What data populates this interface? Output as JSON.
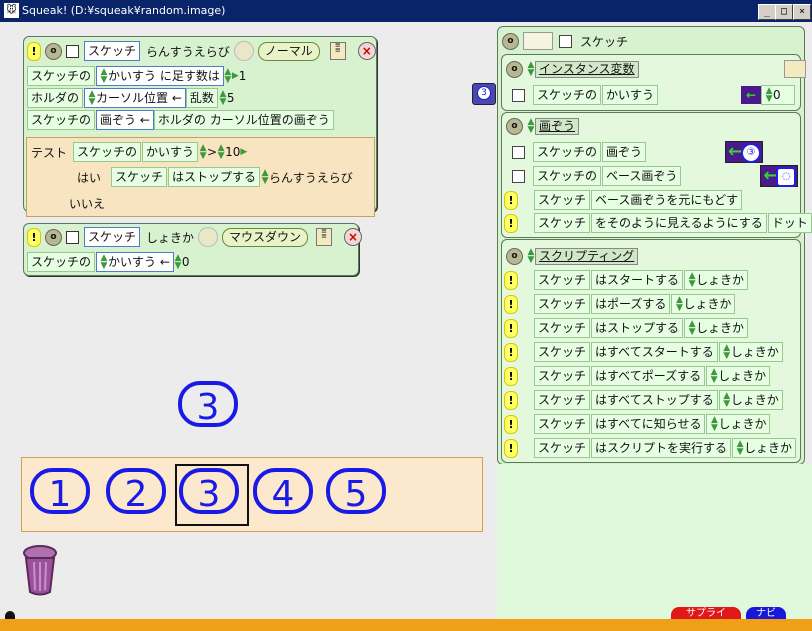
{
  "window": {
    "title": "Squeak! (D:¥squeak¥random.image)",
    "controls": [
      "_",
      "□",
      "×"
    ]
  },
  "script1": {
    "object": "スケッチ",
    "name": "らんすうえらび",
    "trigger": "ノーマル",
    "lines": [
      {
        "prefix": "スケッチの",
        "field": "かいすう",
        "op": "に足す数は",
        "value": "1"
      },
      {
        "prefix": "ホルダの",
        "field": "カーソル位置",
        "op": "乱数",
        "value": "5"
      },
      {
        "prefix": "スケッチの",
        "field": "画ぞう",
        "op": "ホルダの カーソル位置の画ぞう"
      }
    ],
    "test": {
      "label": "テスト",
      "prefix": "スケッチの",
      "field": "かいすう",
      "cmp": ">",
      "value": "10",
      "yes_label": "はい",
      "yes_obj": "スケッチ",
      "yes_action": "はストップする",
      "yes_script": "らんすうえらび",
      "no_label": "いいえ"
    }
  },
  "script2": {
    "object": "スケッチ",
    "name": "しょきか",
    "trigger": "マウスダウン",
    "line": {
      "prefix": "スケッチの",
      "field": "かいすう",
      "value": "0"
    }
  },
  "viewer": {
    "title": "スケッチ",
    "categories": [
      {
        "title": "インスタンス変数",
        "rows": [
          {
            "object": "スケッチの",
            "field": "かいすう",
            "value": "0"
          }
        ]
      },
      {
        "title": "画ぞう",
        "rows": [
          {
            "object": "スケッチの",
            "field": "画ぞう"
          },
          {
            "object": "スケッチの",
            "field": "ベース画ぞう"
          },
          {
            "object": "スケッチ",
            "action": "ベース画ぞうを元にもどす"
          },
          {
            "object": "スケッチ",
            "action": "をそのように見えるようにする",
            "arg": "ドット"
          }
        ]
      },
      {
        "title": "スクリプティング",
        "rows": [
          {
            "object": "スケッチ",
            "action": "はスタートする",
            "arg": "しょきか"
          },
          {
            "object": "スケッチ",
            "action": "はポーズする",
            "arg": "しょきか"
          },
          {
            "object": "スケッチ",
            "action": "はストップする",
            "arg": "しょきか"
          },
          {
            "object": "スケッチ",
            "action": "はすべてスタートする",
            "arg": "しょきか"
          },
          {
            "object": "スケッチ",
            "action": "はすべてポーズする",
            "arg": "しょきか"
          },
          {
            "object": "スケッチ",
            "action": "はすべてストップする",
            "arg": "しょきか"
          },
          {
            "object": "スケッチ",
            "action": "はすべてに知らせる",
            "arg": "しょきか"
          },
          {
            "object": "スケッチ",
            "action": "はスクリプトを実行する",
            "arg": "しょきか"
          }
        ]
      }
    ]
  },
  "sketch": {
    "numeral": "3"
  },
  "holder": {
    "numerals": [
      "1",
      "2",
      "3",
      "4",
      "5"
    ],
    "cursor_index": 2
  },
  "flaps": [
    "サプライ",
    "ナビ"
  ],
  "colors": {
    "numeral": "#1a1ae6",
    "script_bg": "#d8f2d0",
    "holder_bg": "#fce8cc"
  }
}
